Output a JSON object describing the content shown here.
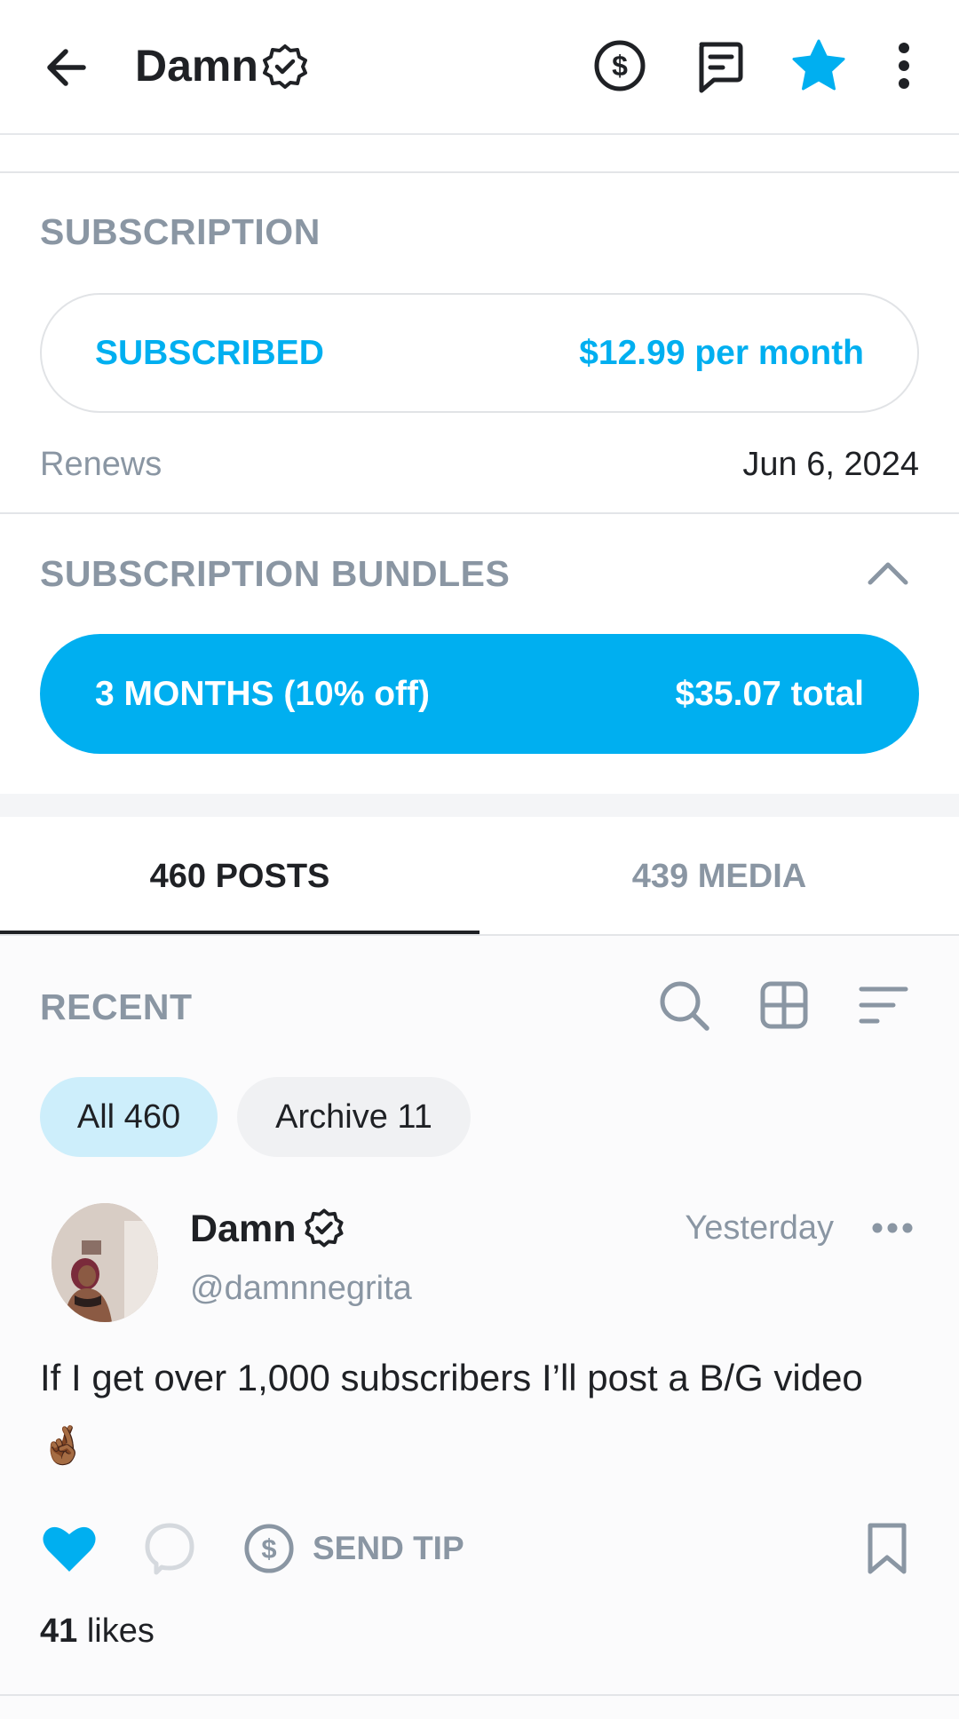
{
  "header": {
    "title": "Damn",
    "icons": [
      "back-arrow-icon",
      "verified-badge-icon",
      "dollar-circle-icon",
      "message-icon",
      "star-icon",
      "more-vertical-icon"
    ]
  },
  "subscription": {
    "section_label": "SUBSCRIPTION",
    "status": "SUBSCRIBED",
    "price": "$12.99 per month",
    "renews_label": "Renews",
    "renews_date": "Jun 6, 2024"
  },
  "bundles": {
    "section_label": "SUBSCRIPTION BUNDLES",
    "bundle_label": "3 MONTHS (10% off)",
    "bundle_total": "$35.07 total"
  },
  "tabs": [
    {
      "label": "460 POSTS",
      "active": true
    },
    {
      "label": "439 MEDIA",
      "active": false
    }
  ],
  "filter": {
    "label": "RECENT",
    "chips": [
      {
        "label": "All 460",
        "active": true
      },
      {
        "label": "Archive 11",
        "active": false
      }
    ]
  },
  "post": {
    "author": "Damn",
    "handle": "@damnnegrita",
    "time": "Yesterday",
    "text": "If I get over 1,000 subscribers I’ll post a B/G video",
    "emoji": "🤞🏾",
    "send_tip_label": "SEND TIP",
    "likes_count": "41",
    "likes_label": "likes"
  },
  "colors": {
    "accent": "#00aff0",
    "muted": "#8a96a3",
    "chip_active_bg": "#cdeefb",
    "chip_bg": "#f0f1f3",
    "text": "#1f2125"
  }
}
